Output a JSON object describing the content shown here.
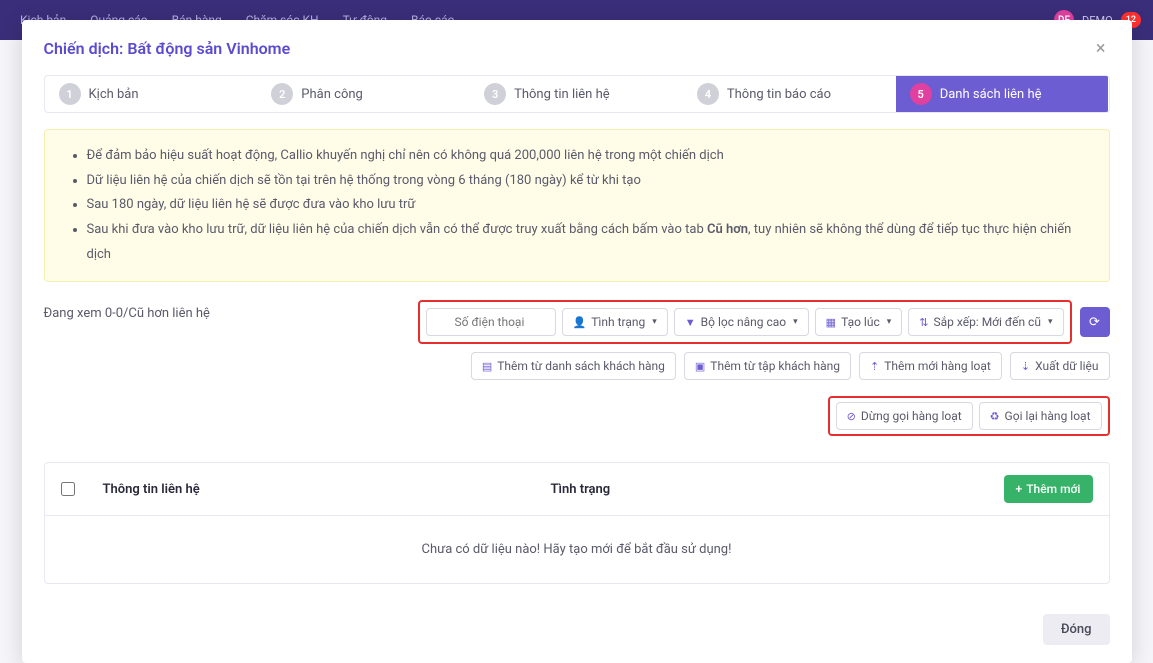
{
  "topbar": {
    "tabs": [
      "Kịch bản",
      "Quảng cáo",
      "Bán hàng",
      "Chăm sóc KH",
      "Tự động",
      "Báo cáo"
    ],
    "demo_initials": "DE",
    "demo_label": "DEMO",
    "notif_count": "12"
  },
  "modal": {
    "title": "Chiến dịch: Bất động sản Vinhome",
    "close_label": "Đóng"
  },
  "steps": [
    {
      "num": "1",
      "label": "Kịch bản"
    },
    {
      "num": "2",
      "label": "Phân công"
    },
    {
      "num": "3",
      "label": "Thông tin liên hệ"
    },
    {
      "num": "4",
      "label": "Thông tin báo cáo"
    },
    {
      "num": "5",
      "label": "Danh sách liên hệ"
    }
  ],
  "warnings": {
    "line1": "Để đảm bảo hiệu suất hoạt động, Callio khuyến nghị chỉ nên có không quá 200,000 liên hệ trong một chiến dịch",
    "line2": "Dữ liệu liên hệ của chiến dịch sẽ tồn tại trên hệ thống trong vòng 6 tháng (180 ngày) kể từ khi tạo",
    "line3": "Sau 180 ngày, dữ liệu liên hệ sẽ được đưa vào kho lưu trữ",
    "line4_a": "Sau khi đưa vào kho lưu trữ, dữ liệu liên hệ của chiến dịch vẫn có thể được truy xuất bằng cách bấm vào tab ",
    "line4_bold": "Cũ hơn",
    "line4_b": ", tuy nhiên sẽ không thể dùng để tiếp tục thực hiện chiến dịch"
  },
  "status": "Đang xem 0-0/Cũ hơn liên hệ",
  "filters": {
    "search_placeholder": "Số điện thoại",
    "status_btn": "Tình trạng",
    "advfilter_btn": "Bộ lọc nâng cao",
    "created_btn": "Tạo lúc",
    "sort_btn": "Sắp xếp: Mới đến cũ"
  },
  "actions": {
    "add_from_list": "Thêm từ danh sách khách hàng",
    "add_from_set": "Thêm từ tập khách hàng",
    "bulk_add": "Thêm mới hàng loạt",
    "export": "Xuất dữ liệu",
    "bulk_stop": "Dừng gọi hàng loạt",
    "bulk_recall": "Gọi lại hàng loạt"
  },
  "table": {
    "col1": "Thông tin liên hệ",
    "col2": "Tình trạng",
    "add_btn": "Thêm mới",
    "empty_msg": "Chưa có dữ liệu nào! Hãy tạo mới để bắt đầu sử dụng!"
  }
}
